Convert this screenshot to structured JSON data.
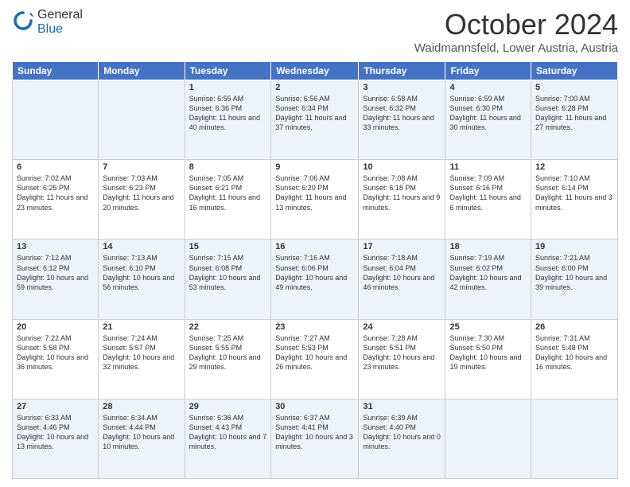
{
  "header": {
    "logo_general": "General",
    "logo_blue": "Blue",
    "month_title": "October 2024",
    "location": "Waidmannsfeld, Lower Austria, Austria"
  },
  "weekdays": [
    "Sunday",
    "Monday",
    "Tuesday",
    "Wednesday",
    "Thursday",
    "Friday",
    "Saturday"
  ],
  "weeks": [
    [
      {
        "day": "",
        "info": ""
      },
      {
        "day": "",
        "info": ""
      },
      {
        "day": "1",
        "info": "Sunrise: 6:55 AM\nSunset: 6:36 PM\nDaylight: 11 hours and 40 minutes."
      },
      {
        "day": "2",
        "info": "Sunrise: 6:56 AM\nSunset: 6:34 PM\nDaylight: 11 hours and 37 minutes."
      },
      {
        "day": "3",
        "info": "Sunrise: 6:58 AM\nSunset: 6:32 PM\nDaylight: 11 hours and 33 minutes."
      },
      {
        "day": "4",
        "info": "Sunrise: 6:59 AM\nSunset: 6:30 PM\nDaylight: 11 hours and 30 minutes."
      },
      {
        "day": "5",
        "info": "Sunrise: 7:00 AM\nSunset: 6:28 PM\nDaylight: 11 hours and 27 minutes."
      }
    ],
    [
      {
        "day": "6",
        "info": "Sunrise: 7:02 AM\nSunset: 6:25 PM\nDaylight: 11 hours and 23 minutes."
      },
      {
        "day": "7",
        "info": "Sunrise: 7:03 AM\nSunset: 6:23 PM\nDaylight: 11 hours and 20 minutes."
      },
      {
        "day": "8",
        "info": "Sunrise: 7:05 AM\nSunset: 6:21 PM\nDaylight: 11 hours and 16 minutes."
      },
      {
        "day": "9",
        "info": "Sunrise: 7:06 AM\nSunset: 6:20 PM\nDaylight: 11 hours and 13 minutes."
      },
      {
        "day": "10",
        "info": "Sunrise: 7:08 AM\nSunset: 6:18 PM\nDaylight: 11 hours and 9 minutes."
      },
      {
        "day": "11",
        "info": "Sunrise: 7:09 AM\nSunset: 6:16 PM\nDaylight: 11 hours and 6 minutes."
      },
      {
        "day": "12",
        "info": "Sunrise: 7:10 AM\nSunset: 6:14 PM\nDaylight: 11 hours and 3 minutes."
      }
    ],
    [
      {
        "day": "13",
        "info": "Sunrise: 7:12 AM\nSunset: 6:12 PM\nDaylight: 10 hours and 59 minutes."
      },
      {
        "day": "14",
        "info": "Sunrise: 7:13 AM\nSunset: 6:10 PM\nDaylight: 10 hours and 56 minutes."
      },
      {
        "day": "15",
        "info": "Sunrise: 7:15 AM\nSunset: 6:08 PM\nDaylight: 10 hours and 53 minutes."
      },
      {
        "day": "16",
        "info": "Sunrise: 7:16 AM\nSunset: 6:06 PM\nDaylight: 10 hours and 49 minutes."
      },
      {
        "day": "17",
        "info": "Sunrise: 7:18 AM\nSunset: 6:04 PM\nDaylight: 10 hours and 46 minutes."
      },
      {
        "day": "18",
        "info": "Sunrise: 7:19 AM\nSunset: 6:02 PM\nDaylight: 10 hours and 42 minutes."
      },
      {
        "day": "19",
        "info": "Sunrise: 7:21 AM\nSunset: 6:00 PM\nDaylight: 10 hours and 39 minutes."
      }
    ],
    [
      {
        "day": "20",
        "info": "Sunrise: 7:22 AM\nSunset: 5:58 PM\nDaylight: 10 hours and 36 minutes."
      },
      {
        "day": "21",
        "info": "Sunrise: 7:24 AM\nSunset: 5:57 PM\nDaylight: 10 hours and 32 minutes."
      },
      {
        "day": "22",
        "info": "Sunrise: 7:25 AM\nSunset: 5:55 PM\nDaylight: 10 hours and 29 minutes."
      },
      {
        "day": "23",
        "info": "Sunrise: 7:27 AM\nSunset: 5:53 PM\nDaylight: 10 hours and 26 minutes."
      },
      {
        "day": "24",
        "info": "Sunrise: 7:28 AM\nSunset: 5:51 PM\nDaylight: 10 hours and 23 minutes."
      },
      {
        "day": "25",
        "info": "Sunrise: 7:30 AM\nSunset: 5:50 PM\nDaylight: 10 hours and 19 minutes."
      },
      {
        "day": "26",
        "info": "Sunrise: 7:31 AM\nSunset: 5:48 PM\nDaylight: 10 hours and 16 minutes."
      }
    ],
    [
      {
        "day": "27",
        "info": "Sunrise: 6:33 AM\nSunset: 4:46 PM\nDaylight: 10 hours and 13 minutes."
      },
      {
        "day": "28",
        "info": "Sunrise: 6:34 AM\nSunset: 4:44 PM\nDaylight: 10 hours and 10 minutes."
      },
      {
        "day": "29",
        "info": "Sunrise: 6:36 AM\nSunset: 4:43 PM\nDaylight: 10 hours and 7 minutes."
      },
      {
        "day": "30",
        "info": "Sunrise: 6:37 AM\nSunset: 4:41 PM\nDaylight: 10 hours and 3 minutes."
      },
      {
        "day": "31",
        "info": "Sunrise: 6:39 AM\nSunset: 4:40 PM\nDaylight: 10 hours and 0 minutes."
      },
      {
        "day": "",
        "info": ""
      },
      {
        "day": "",
        "info": ""
      }
    ]
  ]
}
